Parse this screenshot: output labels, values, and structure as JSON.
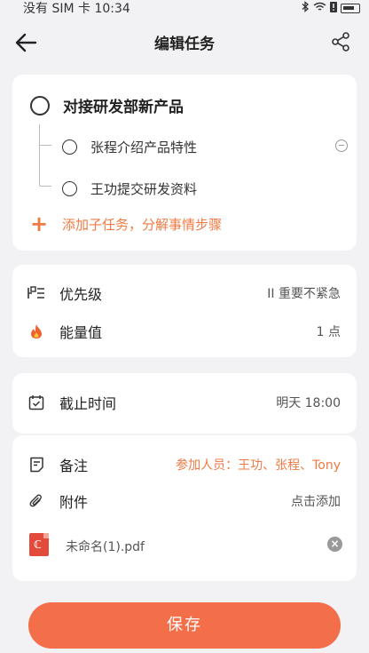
{
  "status_bar": {
    "carrier": "没有 SIM 卡",
    "time": "10:34"
  },
  "header": {
    "title": "编辑任务"
  },
  "task": {
    "title": "对接研发部新产品",
    "subtasks": [
      {
        "label": "张程介绍产品特性"
      },
      {
        "label": "王功提交研发资料"
      }
    ],
    "add_subtask_label": "添加子任务，分解事情步骤"
  },
  "priority": {
    "label": "优先级",
    "value": "II 重要不紧急"
  },
  "energy": {
    "label": "能量值",
    "value": "1 点"
  },
  "deadline": {
    "label": "截止时间",
    "value": "明天 18:00"
  },
  "notes": {
    "label": "备注",
    "value": "参加人员：王功、张程、Tony"
  },
  "attachments": {
    "label": "附件",
    "action": "点击添加",
    "files": [
      {
        "name": "未命名(1).pdf"
      }
    ]
  },
  "footer": {
    "save_label": "保存"
  },
  "colors": {
    "accent": "#f36f4a",
    "accent_text": "#f07a44",
    "background": "#f2f2f4"
  }
}
